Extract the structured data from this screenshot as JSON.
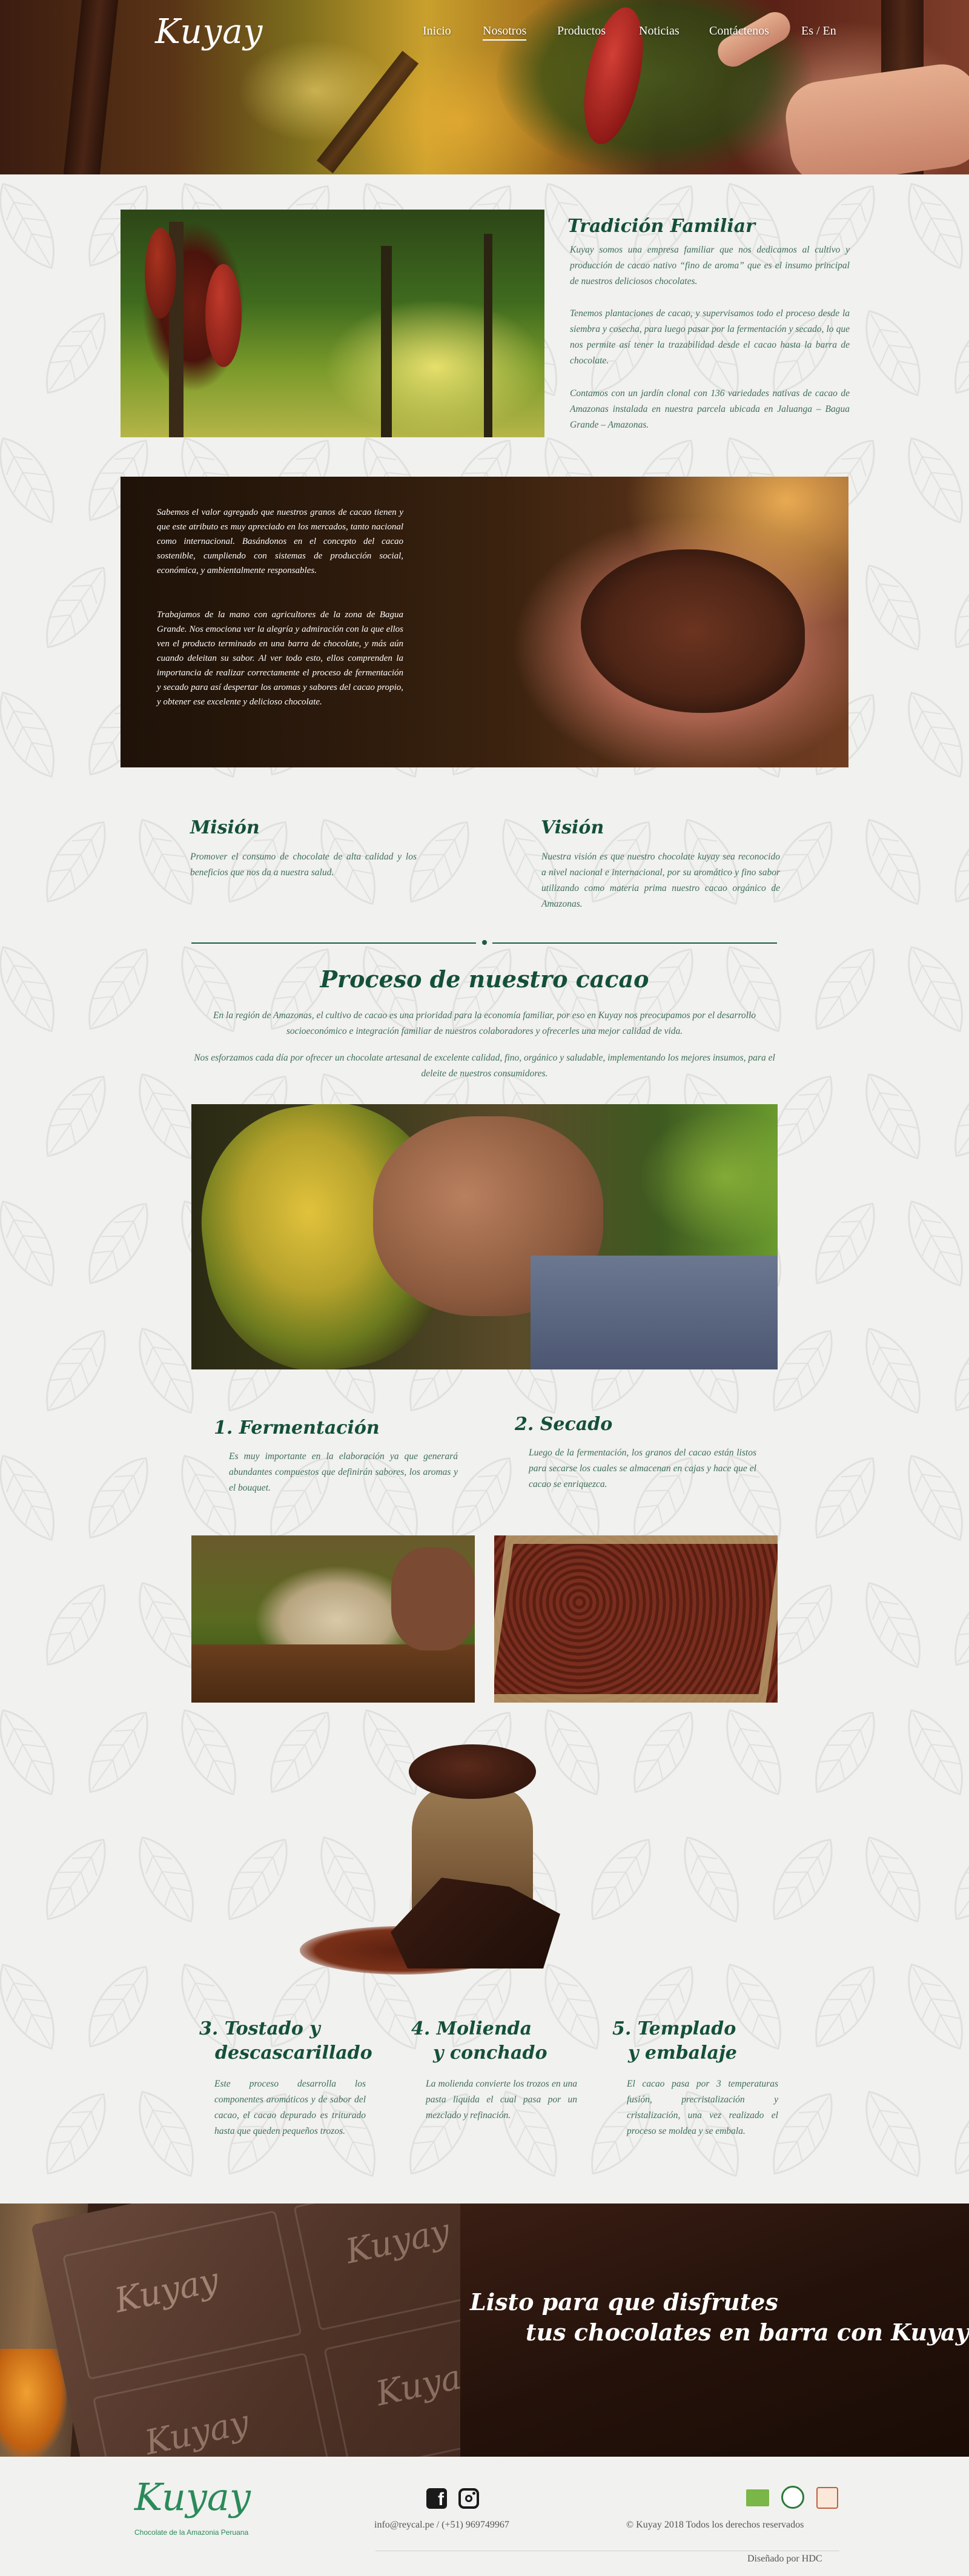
{
  "brand": {
    "logo_text": "Kuyay",
    "tagline": "Chocolate de la Amazonia Peruana"
  },
  "nav": {
    "items": [
      {
        "label": "Inicio"
      },
      {
        "label": "Nosotros"
      },
      {
        "label": "Productos"
      },
      {
        "label": "Noticias"
      },
      {
        "label": "Contáctenos"
      },
      {
        "label": "Es / En"
      }
    ],
    "active": "Nosotros"
  },
  "tradicion": {
    "title": "Tradición Familiar",
    "p1": "Kuyay somos una empresa familiar que nos dedicamos al cultivo y producción de cacao nativo “fino de aroma” que es el insumo principal de nuestros deliciosos chocolates.",
    "p2": "Tenemos plantaciones de cacao, y supervisamos todo el proceso desde la siembra y cosecha, para luego pasar por la fermentación y secado, lo que nos permite así tener la trazabilidad desde el cacao hasta la barra de chocolate.",
    "p3": "Contamos con un jardín clonal con 136 variedades nativas de cacao de Amazonas instalada en nuestra parcela ubicada en Jaluanga – Bagua Grande – Amazonas."
  },
  "valor": {
    "p1": "Sabemos el valor agregado que nuestros granos de cacao tienen y que este atributo es muy apreciado en los mercados, tanto nacional como internacional. Basándonos en el concepto del cacao sostenible, cumpliendo con sistemas de producción social, económica, y ambientalmente responsables.",
    "p2": "Trabajamos de la mano con agricultores de la zona de Bagua Grande. Nos emociona ver la alegría y admiración con la que ellos ven el producto terminado en una barra de chocolate, y más aún cuando deleitan su sabor. Al ver todo esto, ellos comprenden la importancia de realizar correctamente el proceso de fermentación y secado para así despertar los aromas y sabores del cacao propio, y obtener ese excelente y delicioso chocolate."
  },
  "mision": {
    "title": "Misión",
    "text": "Promover el consumo de chocolate de alta calidad y los beneficios que nos da a nuestra salud."
  },
  "vision": {
    "title": "Visión",
    "text": "Nuestra visión es que nuestro chocolate kuyay sea reconocido a nivel nacional e internacional, por su aromático y fino sabor utilizando como materia prima nuestro cacao orgánico de Amazonas."
  },
  "proceso": {
    "title": "Proceso de nuestro cacao",
    "p1": "En la región de Amazonas, el cultivo de cacao es una prioridad para la economía familiar, por eso en Kuyay nos preocupamos por el desarrollo socioeconómico e integración familiar de nuestros colaboradores y ofrecerles una mejor calidad de vida.",
    "p2": "Nos esforzamos cada día por ofrecer un chocolate artesanal de excelente calidad, fino, orgánico y saludable, implementando los mejores insumos, para el deleite de nuestros consumidores."
  },
  "steps": [
    {
      "title": "1. Fermentación",
      "text": "Es muy importante en la elaboración ya que generará abundantes compuestos que definirán sabores, los aromas y el bouquet."
    },
    {
      "title": "2. Secado",
      "text": "Luego de la fermentación, los granos del cacao están listos para secarse los cuales se almacenan en cajas y hace que el cacao se enriquezca."
    },
    {
      "title_a": "3. Tostado y",
      "title_b": "descascarillado",
      "text": "Este proceso desarrolla los componentes aromáticos y de sabor del cacao, el cacao depurado es triturado hasta que queden pequeños trozos."
    },
    {
      "title_a": "4. Molienda",
      "title_b": "y conchado",
      "text": "La molienda convierte los trozos en una pasta liquida el cual pasa por un mezclado y refinación."
    },
    {
      "title_a": "5. Templado",
      "title_b": "y embalaje",
      "text": "El cacao pasa por 3 temperaturas fusión, precristalización y cristalización, una vez realizado el proceso se moldea y se embala."
    }
  ],
  "banner": {
    "line1": "Listo para que disfrutes",
    "line2": "tus chocolates en barra con Kuyay",
    "bar_text": "Kuyay"
  },
  "footer": {
    "contact": "info@reycal.pe / (+51) 969749967",
    "copyright": "© Kuyay 2018 Todos los derechos reservados",
    "designed": "Diseñado por HDC",
    "social": [
      "facebook-icon",
      "instagram-icon"
    ],
    "cert_badges": [
      "eu-organic-badge",
      "usda-organic-badge",
      "fair-trade-badge"
    ]
  }
}
